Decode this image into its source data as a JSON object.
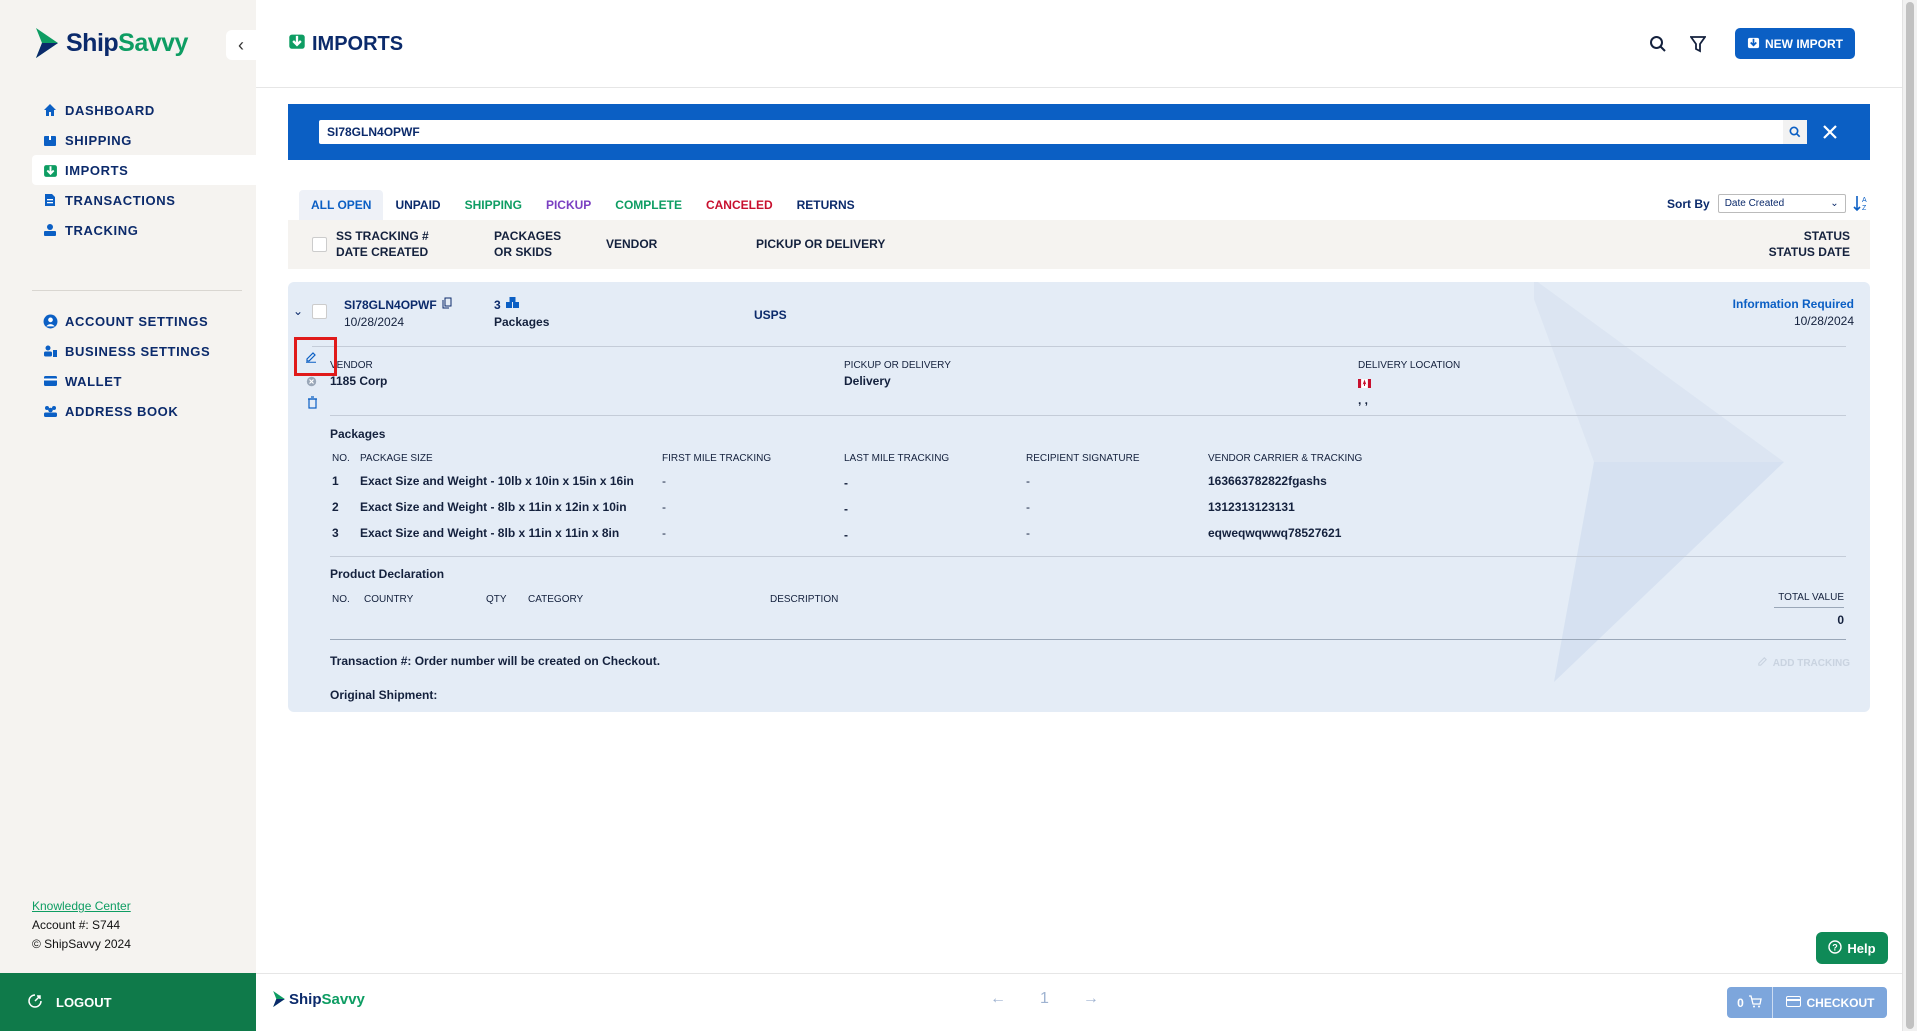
{
  "brand": {
    "name_part1": "Ship",
    "name_part2": "Savvy",
    "colors": {
      "navy": "#0b2a6b",
      "green": "#0e9d63",
      "blue": "#0b5fc4",
      "red": "#c8102e"
    }
  },
  "sidebar": {
    "items": [
      {
        "label": "DASHBOARD",
        "icon": "home-icon"
      },
      {
        "label": "SHIPPING",
        "icon": "box-icon"
      },
      {
        "label": "IMPORTS",
        "icon": "import-icon",
        "active": true
      },
      {
        "label": "TRANSACTIONS",
        "icon": "document-icon"
      },
      {
        "label": "TRACKING",
        "icon": "tracking-icon"
      }
    ],
    "settings": [
      {
        "label": "ACCOUNT SETTINGS",
        "icon": "user-icon"
      },
      {
        "label": "BUSINESS SETTINGS",
        "icon": "business-icon"
      },
      {
        "label": "WALLET",
        "icon": "wallet-icon"
      },
      {
        "label": "ADDRESS BOOK",
        "icon": "address-book-icon"
      }
    ],
    "knowledge_center": "Knowledge Center",
    "account": "Account #: S744",
    "copyright": "© ShipSavvy 2024",
    "logout": "LOGOUT"
  },
  "header": {
    "title": "IMPORTS",
    "new_import": "NEW IMPORT"
  },
  "search": {
    "value": "SI78GLN4OPWF"
  },
  "tabs": [
    {
      "label": "ALL OPEN",
      "color": "#0b5fc4",
      "active": true
    },
    {
      "label": "UNPAID",
      "color": "#0b2a6b"
    },
    {
      "label": "SHIPPING",
      "color": "#0e9d63"
    },
    {
      "label": "PICKUP",
      "color": "#7a3fc2"
    },
    {
      "label": "COMPLETE",
      "color": "#0e9d63"
    },
    {
      "label": "CANCELED",
      "color": "#c8102e"
    },
    {
      "label": "RETURNS",
      "color": "#0b2a6b"
    }
  ],
  "sort": {
    "label": "Sort By",
    "value": "Date Created"
  },
  "table_header": {
    "tracking_1": "SS TRACKING #",
    "tracking_2": "DATE CREATED",
    "packages_1": "PACKAGES",
    "packages_2": "OR SKIDS",
    "vendor": "VENDOR",
    "pickup": "PICKUP OR DELIVERY",
    "status_1": "STATUS",
    "status_2": "STATUS DATE"
  },
  "shipment": {
    "tracking": "SI78GLN4OPWF",
    "date": "10/28/2024",
    "packages_count": "3",
    "packages_label": "Packages",
    "carrier": "USPS",
    "status": "Information Required",
    "status_date": "10/28/2024",
    "vendor_label": "VENDOR",
    "vendor": "1185 Corp",
    "pickup_label": "PICKUP OR DELIVERY",
    "pickup": "Delivery",
    "delivery_label": "DELIVERY LOCATION",
    "delivery_value": ", ,",
    "packages_title": "Packages",
    "pkg_headers": [
      "NO.",
      "PACKAGE SIZE",
      "FIRST MILE TRACKING",
      "LAST MILE TRACKING",
      "RECIPIENT SIGNATURE",
      "VENDOR CARRIER & TRACKING"
    ],
    "pkg_rows": [
      {
        "no": "1",
        "size": "Exact Size and Weight - 10lb x 10in x 15in x 16in",
        "first": "-",
        "last": "-",
        "sig": "-",
        "vendor_tracking": "163663782822fgashs"
      },
      {
        "no": "2",
        "size": "Exact Size and Weight - 8lb x 11in x 12in x 10in",
        "first": "-",
        "last": "-",
        "sig": "-",
        "vendor_tracking": "1312313123131"
      },
      {
        "no": "3",
        "size": "Exact Size and Weight - 8lb x 11in x 11in x 8in",
        "first": "-",
        "last": "-",
        "sig": "-",
        "vendor_tracking": "eqweqwqwwq78527621"
      }
    ],
    "product_title": "Product Declaration",
    "prod_headers": [
      "NO.",
      "COUNTRY",
      "QTY",
      "CATEGORY",
      "DESCRIPTION",
      "TOTAL VALUE"
    ],
    "total_value": "0",
    "transaction": "Transaction #: Order number will be created on Checkout.",
    "original": "Original Shipment:",
    "add_tracking": "ADD TRACKING"
  },
  "footer": {
    "page": "1",
    "cart_count": "0",
    "checkout": "CHECKOUT"
  },
  "help": "Help"
}
